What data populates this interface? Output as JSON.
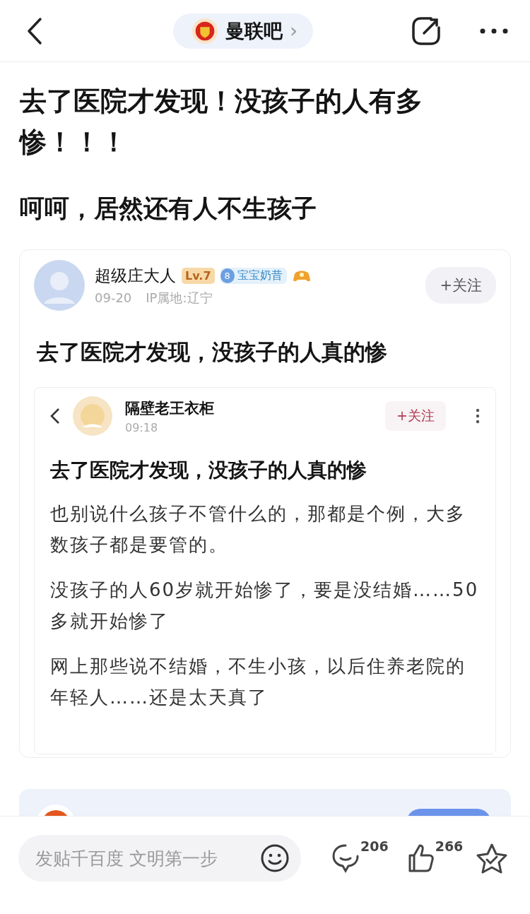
{
  "top_bar": {
    "forum_name": "曼联吧",
    "chevron": "›"
  },
  "post": {
    "title": "去了医院才发现！没孩子的人有多惨！！！",
    "text": "呵呵，居然还有人不生孩子"
  },
  "quoted_post": {
    "author": "超级庄大人",
    "level": "Lv.7",
    "badge_number": "8",
    "badge_label": "宝宝奶昔",
    "date": "09-20",
    "ip": "IP属地:辽宁",
    "follow": "+关注",
    "title": "去了医院才发现，没孩子的人真的惨",
    "screenshot": {
      "author": "隔壁老王衣柜",
      "time": "09:18",
      "follow": "+关注",
      "title": "去了医院才发现，没孩子的人真的惨",
      "paragraphs": [
        "也别说什么孩子不管什么的，那都是个例，大多数孩子都是要管的。",
        "没孩子的人60岁就开始惨了，要是没结婚……50多就开始惨了",
        "网上那些说不结婚，不生小孩，以后住养老院的年轻人……还是太天真了"
      ]
    }
  },
  "bottom_bar": {
    "placeholder": "发贴千百度 文明第一步",
    "comments": "206",
    "likes": "266"
  }
}
